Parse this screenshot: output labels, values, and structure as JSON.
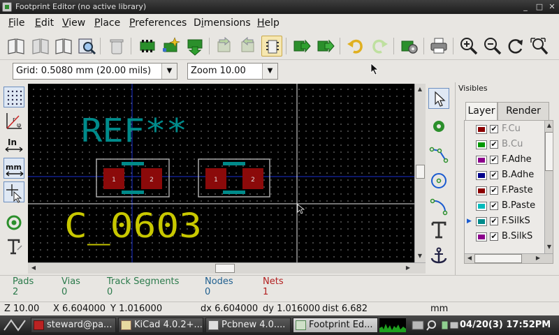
{
  "window": {
    "title": "Footprint Editor (no active library)"
  },
  "menu": [
    {
      "label": "File",
      "ul": "F",
      "rest": "ile"
    },
    {
      "label": "Edit",
      "ul": "E",
      "rest": "dit"
    },
    {
      "label": "View",
      "ul": "V",
      "rest": "iew"
    },
    {
      "label": "Place",
      "ul": "P",
      "rest": "lace"
    },
    {
      "label": "Preferences",
      "ul": "P",
      "rest": "references"
    },
    {
      "label": "Dimensions",
      "pre": "D",
      "ul": "i",
      "rest": "mensions"
    },
    {
      "label": "Help",
      "ul": "H",
      "rest": "elp"
    }
  ],
  "options": {
    "grid": "Grid: 0.5080 mm (20.00 mils)",
    "zoom": "Zoom 10.00"
  },
  "canvas": {
    "reference": "REF**",
    "value": "C_0603",
    "pads": [
      "1",
      "2",
      "1",
      "2"
    ]
  },
  "visibles": {
    "title": "Visibles",
    "tabs": [
      "Layer",
      "Render"
    ],
    "layers": [
      {
        "name": "F.Cu",
        "color": "#8b0000",
        "checked": true,
        "dim": true,
        "active": false
      },
      {
        "name": "B.Cu",
        "color": "#009900",
        "checked": true,
        "dim": true,
        "active": false
      },
      {
        "name": "F.Adhe",
        "color": "#8b008b",
        "checked": true,
        "dim": false,
        "active": false
      },
      {
        "name": "B.Adhe",
        "color": "#00008b",
        "checked": true,
        "dim": false,
        "active": false
      },
      {
        "name": "F.Paste",
        "color": "#8b0000",
        "checked": true,
        "dim": false,
        "active": false
      },
      {
        "name": "B.Paste",
        "color": "#00bbbb",
        "checked": true,
        "dim": false,
        "active": false
      },
      {
        "name": "F.SilkS",
        "color": "#008b8b",
        "checked": true,
        "dim": false,
        "active": true
      },
      {
        "name": "B.SilkS",
        "color": "#8b008b",
        "checked": true,
        "dim": false,
        "active": false
      }
    ]
  },
  "messages": {
    "pads": {
      "label": "Pads",
      "value": "2"
    },
    "vias": {
      "label": "Vias",
      "value": "0"
    },
    "tracks": {
      "label": "Track Segments",
      "value": "0"
    },
    "nodes": {
      "label": "Nodes",
      "value": "0"
    },
    "nets": {
      "label": "Nets",
      "value": "1"
    }
  },
  "status": {
    "zoom": "Z 10.00",
    "x": "X 6.604000",
    "y": "Y 1.016000",
    "dx": "dx 6.604000",
    "dy": "dy 1.016000",
    "dist": "dist 6.682",
    "units": "mm"
  },
  "taskbar": {
    "items": [
      "steward@pa...",
      "KiCad 4.0.2+...",
      "Pcbnew 4.0....",
      "Footprint Ed..."
    ],
    "clock": "04/20(3) 17:52PM"
  },
  "colors": {
    "silk_front": "#008b8b",
    "fab_value": "#c8c800",
    "pad": "#8b0a0a",
    "courtyard": "#b4b4b4"
  }
}
